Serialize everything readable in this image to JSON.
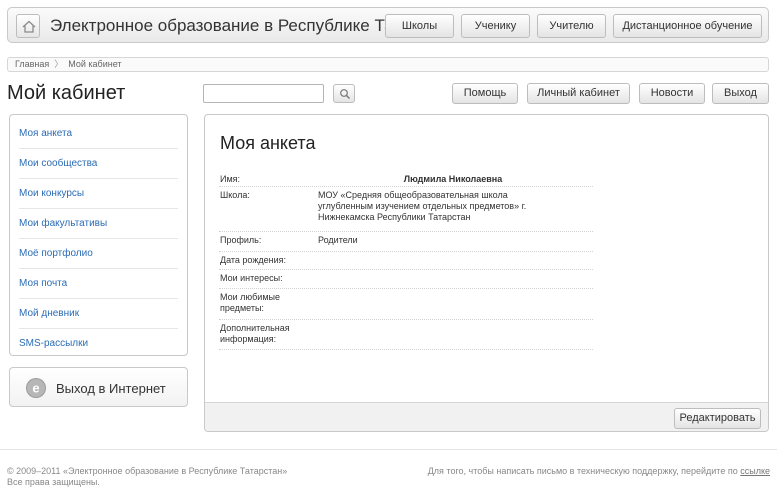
{
  "header": {
    "home_icon": "home-icon",
    "site_title": "Электронное образование в Республике Татарстан",
    "nav": [
      "Школы",
      "Ученику",
      "Учителю",
      "Дистанционное обучение"
    ]
  },
  "breadcrumb": {
    "items": [
      "Главная",
      "Мой кабинет"
    ],
    "separator": "〉"
  },
  "page_title": "Мой кабинет",
  "search": {
    "value": "",
    "placeholder": "",
    "icon": "magnifier-icon"
  },
  "top_buttons": [
    "Помощь",
    "Личный кабинет",
    "Новости",
    "Выход"
  ],
  "sidebar": {
    "items": [
      "Моя анкета",
      "Мои сообщества",
      "Мои конкурсы",
      "Мои факультативы",
      "Моё портфолио",
      "Моя почта",
      "Мой дневник",
      "SMS-рассылки"
    ],
    "internet_exit": "Выход в Интернет",
    "internet_icon": "browser-icon"
  },
  "main": {
    "title": "Моя анкета",
    "fields": [
      {
        "label": "Имя:",
        "value": "Людмила Николаевна"
      },
      {
        "label": "Школа:",
        "value": "МОУ «Средняя общеобразовательная школа углубленным изучением отдельных предметов» г. Нижнекамска Республики Татарстан"
      },
      {
        "label": "Профиль:",
        "value": "Родители"
      },
      {
        "label": "Дата рождения:",
        "value": ""
      },
      {
        "label": "Мои интересы:",
        "value": ""
      },
      {
        "label": "Мои любимые предметы:",
        "value": ""
      },
      {
        "label": "Дополнительная информация:",
        "value": ""
      }
    ],
    "edit_button": "Редактировать"
  },
  "footer": {
    "copyright_line1": "© 2009–2011 «Электронное образование в Республике Татарстан»",
    "copyright_line2": "Все права защищены.",
    "support_text": "Для того, чтобы написать письмо в техническую поддержку, перейдите по",
    "support_link": "ссылке"
  },
  "colors": {
    "link": "#2a6cb5",
    "border": "#c9c9c9",
    "panel_footer": "#f1f1f1"
  }
}
